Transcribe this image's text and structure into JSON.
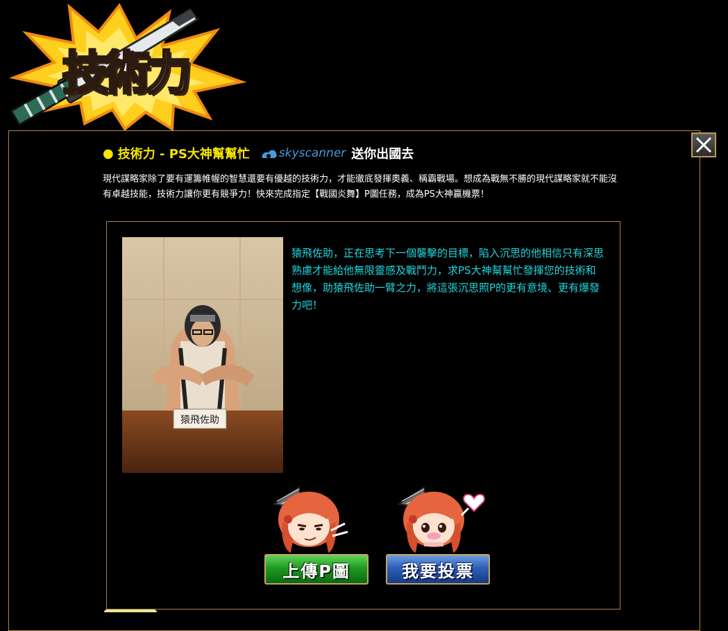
{
  "banner": {
    "title": "技術力",
    "sword_icon": "katana-icon",
    "burst_colors": [
      "#ffcf1e",
      "#f08a12"
    ]
  },
  "close": {
    "icon": "close-icon"
  },
  "heading": {
    "bullet": "●",
    "title": "技術力 - PS大神幫幫忙",
    "sponsor": "skyscanner",
    "suffix": "送你出國去"
  },
  "intro": "現代謀略家除了要有運籌帷幄的智慧還要有優越的技術力，才能徹底發揮奧義、稱霸戰場。想成為戰無不勝的現代謀略家就不能沒有卓越技能，技術力讓你更有競爭力！快來完成指定【戰國炎舞】P圖任務，成為PS大神贏機票！",
  "photo": {
    "nameplate": "猿飛佐助"
  },
  "story": "猿飛佐助，正在思考下一個襲擊的目標，陷入沉思的他相信只有深思熟慮才能給他無限靈感及戰鬥力，求PS大神幫幫忙發揮您的技術和想像，助猿飛佐助一臂之力，將這張沉思照P的更有意境、更有爆發力吧！",
  "buttons": {
    "upload": "上傳P圖",
    "vote": "我要投票"
  },
  "colors": {
    "accent_yellow": "#f5e400",
    "story_cyan": "#21d6dd",
    "border_gold": "#b58a44",
    "skyscanner_blue": "#4a98d6"
  }
}
